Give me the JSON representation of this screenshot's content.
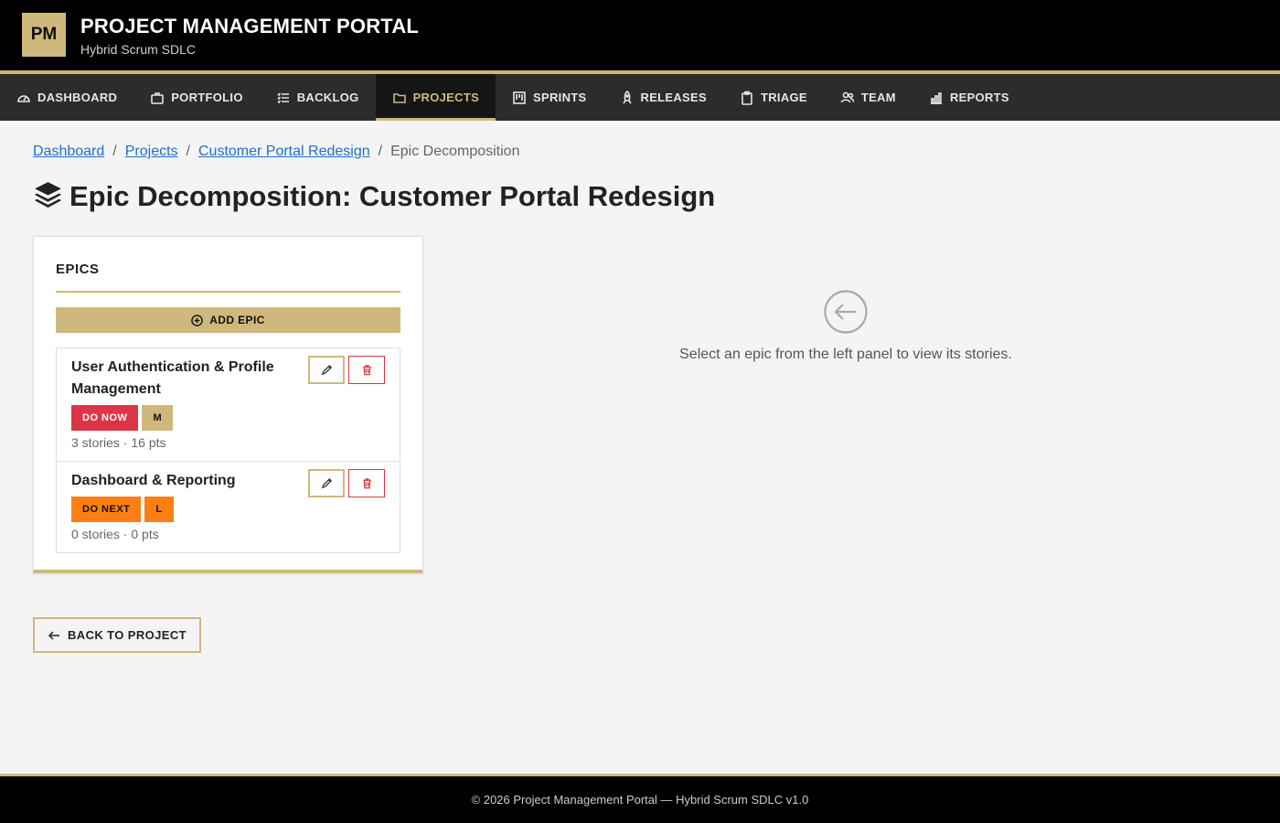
{
  "header": {
    "logo_text": "PM",
    "title": "PROJECT MANAGEMENT PORTAL",
    "subtitle": "Hybrid Scrum SDLC"
  },
  "nav": {
    "items": [
      {
        "label": "DASHBOARD",
        "icon": "gauge-icon"
      },
      {
        "label": "PORTFOLIO",
        "icon": "briefcase-icon"
      },
      {
        "label": "BACKLOG",
        "icon": "list-check-icon"
      },
      {
        "label": "PROJECTS",
        "icon": "folder-icon",
        "active": true
      },
      {
        "label": "SPRINTS",
        "icon": "kanban-icon"
      },
      {
        "label": "RELEASES",
        "icon": "rocket-icon"
      },
      {
        "label": "TRIAGE",
        "icon": "clipboard-icon"
      },
      {
        "label": "TEAM",
        "icon": "people-icon"
      },
      {
        "label": "REPORTS",
        "icon": "bar-chart-icon"
      }
    ]
  },
  "breadcrumb": {
    "items": [
      "Dashboard",
      "Projects",
      "Customer Portal Redesign"
    ],
    "current": "Epic Decomposition"
  },
  "page": {
    "title": "Epic Decomposition: Customer Portal Redesign"
  },
  "epics_panel": {
    "heading": "EPICS",
    "add_label": "ADD EPIC",
    "epics": [
      {
        "name": "User Authentication & Profile Management",
        "priority": "DO NOW",
        "size": "M",
        "stats": "3 stories · 16 pts"
      },
      {
        "name": "Dashboard & Reporting",
        "priority": "DO NEXT",
        "size": "L",
        "stats": "0 stories · 0 pts"
      }
    ]
  },
  "empty_state": {
    "message": "Select an epic from the left panel to view its stories."
  },
  "back_button": {
    "label": "BACK TO PROJECT"
  },
  "footer": {
    "text": "© 2026 Project Management Portal — Hybrid Scrum SDLC v1.0"
  },
  "colors": {
    "accent_gold": "#cfb87c",
    "danger": "#dc3545",
    "warning_orange": "#fd7e14",
    "link_blue": "#1f6fcf"
  }
}
